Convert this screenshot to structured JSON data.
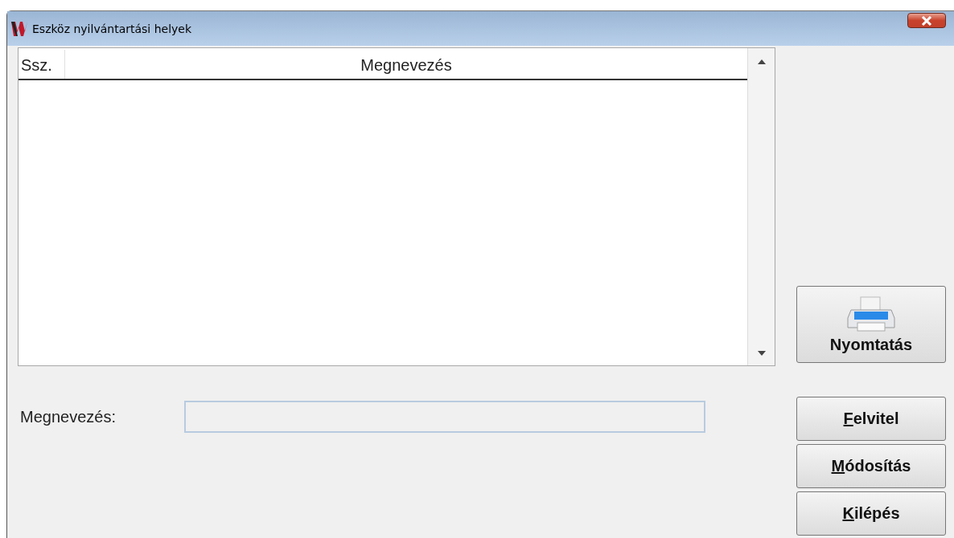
{
  "window": {
    "title": "Eszköz nyilvántartási helyek"
  },
  "table": {
    "columns": [
      {
        "label": "Ssz."
      },
      {
        "label": "Megnevezés"
      }
    ]
  },
  "form": {
    "label": "Megnevezés:"
  },
  "buttons": [
    {
      "kind": "print",
      "label": "Nyomtatás",
      "underline_first": false
    },
    {
      "kind": "plain",
      "label": "Felvitel",
      "underline_first": true
    },
    {
      "kind": "plain",
      "label": "Módosítás",
      "underline_first": true
    },
    {
      "kind": "plain",
      "label": "Kilépés",
      "underline_first": true
    }
  ]
}
